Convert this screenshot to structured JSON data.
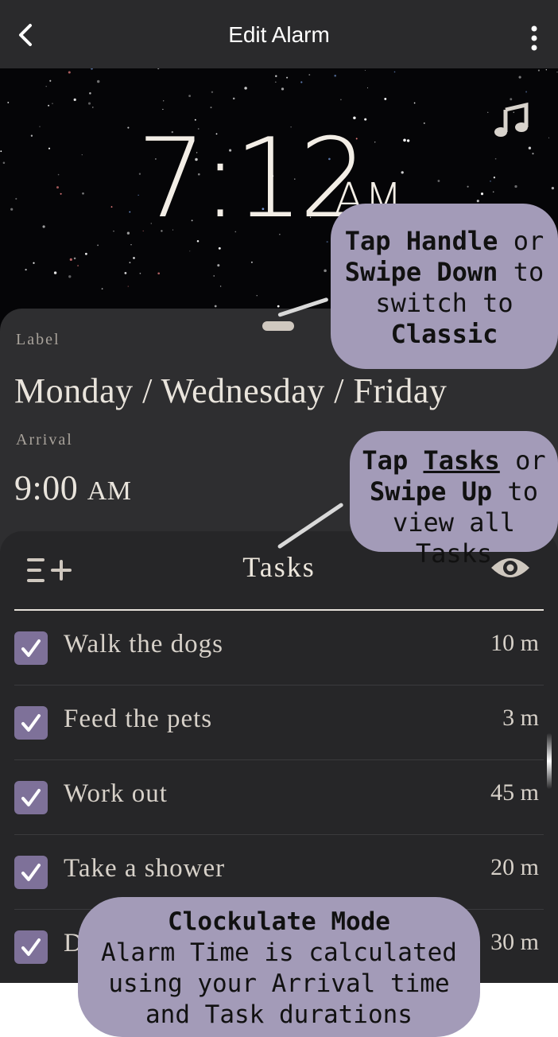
{
  "header": {
    "title": "Edit Alarm",
    "back_icon": "chevron-left-icon",
    "menu_icon": "more-vertical-icon"
  },
  "alarm": {
    "time": "7:12",
    "meridiem": "AM",
    "sound_icon": "music-note-icon"
  },
  "details": {
    "label_caption": "Label",
    "label_value": "Monday / Wednesday / Friday",
    "arrival_caption": "Arrival",
    "arrival_time": "9:00",
    "arrival_meridiem": "AM"
  },
  "tasks": {
    "title": "Tasks",
    "add_icon": "add-task-icon",
    "view_icon": "eye-icon",
    "items": [
      {
        "name": "Walk the dogs",
        "duration": "10 m",
        "checked": true
      },
      {
        "name": "Feed the pets",
        "duration": "3 m",
        "checked": true
      },
      {
        "name": "Work out",
        "duration": "45 m",
        "checked": true
      },
      {
        "name": "Take a shower",
        "duration": "20 m",
        "checked": true
      },
      {
        "name": "D",
        "duration": "30 m",
        "checked": true
      }
    ]
  },
  "callouts": {
    "handle": {
      "l1a": "Tap Handle",
      "l1b": " or",
      "l2a": "Swipe Down",
      "l2b": " to",
      "l3": "switch to",
      "l4": "Classic"
    },
    "tasks": {
      "l1a": "Tap ",
      "l1b": "Tasks",
      "l1c": " or",
      "l2a": "Swipe Up",
      "l2b": " to",
      "l3": "view all Tasks"
    },
    "mode": {
      "l1": "Clockulate Mode",
      "l2": "Alarm Time is calculated",
      "l3": "using your Arrival time",
      "l4": "and Task durations"
    }
  },
  "colors": {
    "background": "#2b2b2d",
    "accent_check": "#7e7199",
    "callout": "#a39bb8",
    "text_light": "#e9e4dc"
  }
}
